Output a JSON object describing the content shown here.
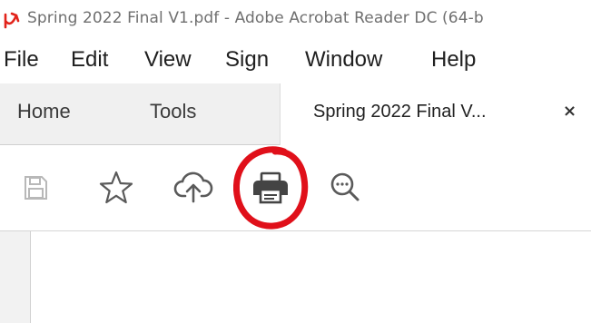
{
  "window": {
    "title": "Spring 2022 Final V1.pdf - Adobe Acrobat Reader DC (64-b"
  },
  "menu": {
    "items": [
      "File",
      "Edit",
      "View",
      "Sign",
      "Window",
      "Help"
    ]
  },
  "tabs": {
    "home": "Home",
    "tools": "Tools",
    "document": "Spring 2022 Final V...",
    "close_glyph": "×"
  },
  "toolbar": {
    "icons": [
      "save-icon",
      "bookmark-star-icon",
      "upload-cloud-icon",
      "print-icon",
      "zoom-search-icon"
    ]
  },
  "colors": {
    "acrobat_red": "#e2231a",
    "annotation_red": "#e0101a",
    "icon_gray": "#6b6b6b",
    "disabled_gray": "#b8b8b8"
  }
}
